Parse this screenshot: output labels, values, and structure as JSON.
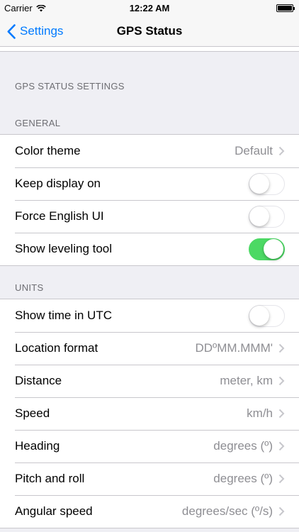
{
  "status_bar": {
    "carrier": "Carrier",
    "time": "12:22 AM"
  },
  "nav": {
    "back_label": "Settings",
    "title": "GPS Status"
  },
  "sections": {
    "top_header": "GPS STATUS SETTINGS",
    "general_header": "GENERAL",
    "units_header": "UNITS"
  },
  "general": {
    "color_theme": {
      "label": "Color theme",
      "value": "Default"
    },
    "keep_display_on": {
      "label": "Keep display on",
      "on": false
    },
    "force_english": {
      "label": "Force English UI",
      "on": false
    },
    "show_leveling": {
      "label": "Show leveling tool",
      "on": true
    }
  },
  "units": {
    "show_utc": {
      "label": "Show time in UTC",
      "on": false
    },
    "location_format": {
      "label": "Location format",
      "value": "DDºMM.MMM'"
    },
    "distance": {
      "label": "Distance",
      "value": "meter, km"
    },
    "speed": {
      "label": "Speed",
      "value": "km/h"
    },
    "heading": {
      "label": "Heading",
      "value": "degrees (º)"
    },
    "pitch_roll": {
      "label": "Pitch and roll",
      "value": "degrees (º)"
    },
    "angular_speed": {
      "label": "Angular speed",
      "value": "degrees/sec (º/s)"
    }
  },
  "colors": {
    "accent": "#007aff",
    "toggle_on": "#4cd964"
  },
  "icons": {
    "back": "chevron-left-icon",
    "row_disclosure": "chevron-right-icon",
    "wifi": "wifi-icon",
    "battery": "battery-icon"
  }
}
